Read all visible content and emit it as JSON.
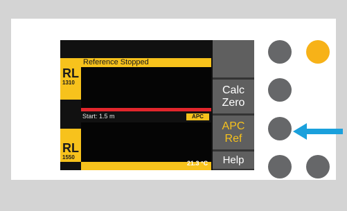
{
  "display": {
    "status": "Reference Stopped",
    "top_channel": {
      "label": "RL",
      "wavelength": "1310"
    },
    "bottom_channel": {
      "label": "RL",
      "wavelength": "1550"
    },
    "start_text": "Start: 1.5 m",
    "apc_badge": "APC",
    "temperature": "21.3 °C"
  },
  "soft_keys": {
    "calc_zero": [
      "Calc",
      "Zero"
    ],
    "apc_ref": [
      "APC",
      "Ref"
    ],
    "help": "Help"
  },
  "colors": {
    "accent_yellow": "#f7c21c",
    "active_button": "#f7b218",
    "arrow_blue": "#1aa0dc",
    "trace_red": "#e2262c"
  },
  "icons": {
    "pointer": "arrow-left-icon"
  }
}
